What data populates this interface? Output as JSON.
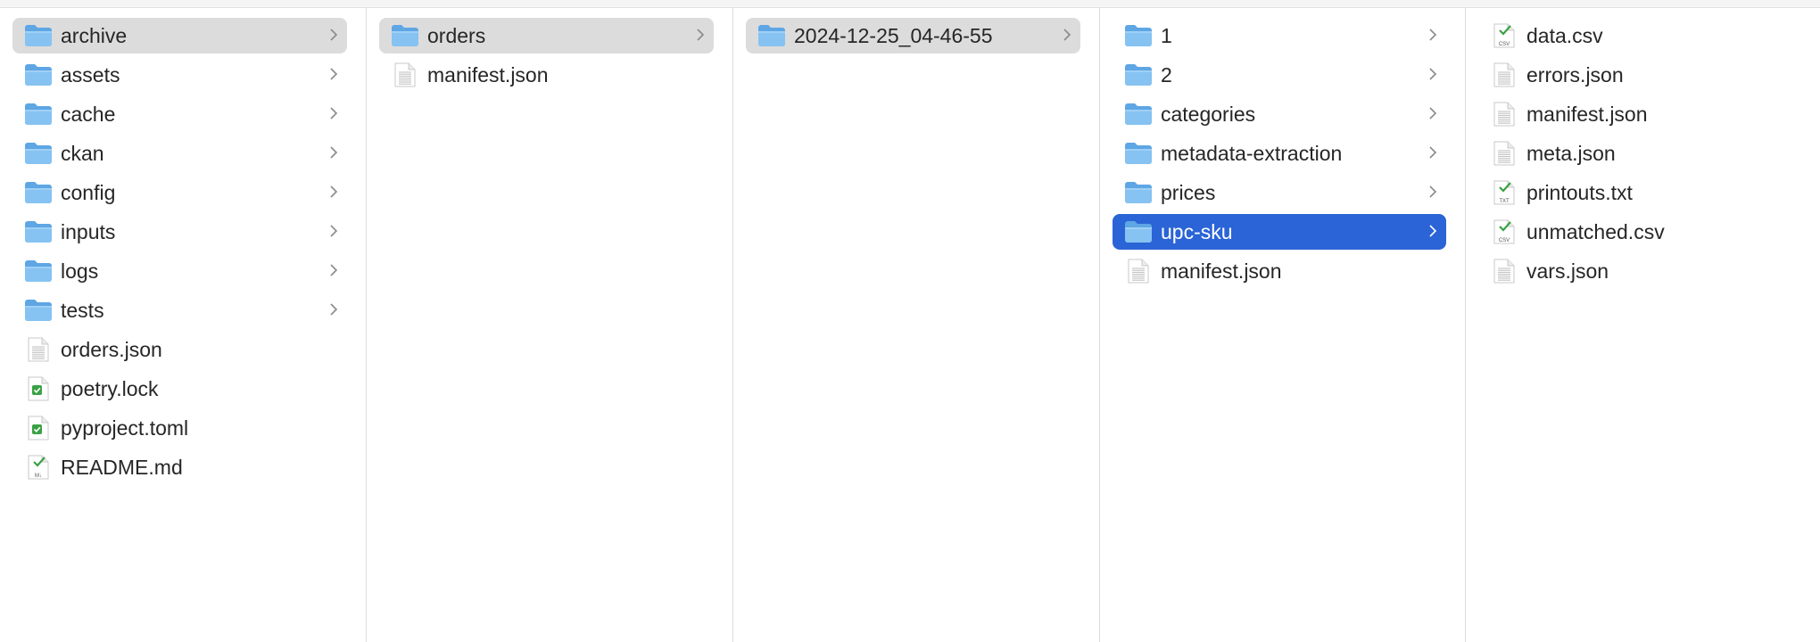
{
  "columns": [
    {
      "items": [
        {
          "name": "archive",
          "type": "folder",
          "selected": true
        },
        {
          "name": "assets",
          "type": "folder"
        },
        {
          "name": "cache",
          "type": "folder"
        },
        {
          "name": "ckan",
          "type": "folder"
        },
        {
          "name": "config",
          "type": "folder"
        },
        {
          "name": "inputs",
          "type": "folder"
        },
        {
          "name": "logs",
          "type": "folder"
        },
        {
          "name": "tests",
          "type": "folder"
        },
        {
          "name": "orders.json",
          "type": "file"
        },
        {
          "name": "poetry.lock",
          "type": "file-check"
        },
        {
          "name": "pyproject.toml",
          "type": "file-check"
        },
        {
          "name": "README.md",
          "type": "file-md",
          "badge": "M↓"
        }
      ]
    },
    {
      "items": [
        {
          "name": "orders",
          "type": "folder",
          "selected": true
        },
        {
          "name": "manifest.json",
          "type": "file"
        }
      ]
    },
    {
      "items": [
        {
          "name": "2024-12-25_04-46-55",
          "type": "folder",
          "selected": true
        }
      ]
    },
    {
      "items": [
        {
          "name": "1",
          "type": "folder"
        },
        {
          "name": "2",
          "type": "folder"
        },
        {
          "name": "categories",
          "type": "folder"
        },
        {
          "name": "metadata-extraction",
          "type": "folder"
        },
        {
          "name": "prices",
          "type": "folder"
        },
        {
          "name": "upc-sku",
          "type": "folder",
          "selected": true,
          "active": true
        },
        {
          "name": "manifest.json",
          "type": "file"
        }
      ]
    },
    {
      "items": [
        {
          "name": "data.csv",
          "type": "file-csv",
          "badge": "CSV"
        },
        {
          "name": "errors.json",
          "type": "file"
        },
        {
          "name": "manifest.json",
          "type": "file"
        },
        {
          "name": "meta.json",
          "type": "file"
        },
        {
          "name": "printouts.txt",
          "type": "file-txt",
          "badge": "TXT"
        },
        {
          "name": "unmatched.csv",
          "type": "file-csv",
          "badge": "CSV"
        },
        {
          "name": "vars.json",
          "type": "file"
        }
      ]
    }
  ]
}
